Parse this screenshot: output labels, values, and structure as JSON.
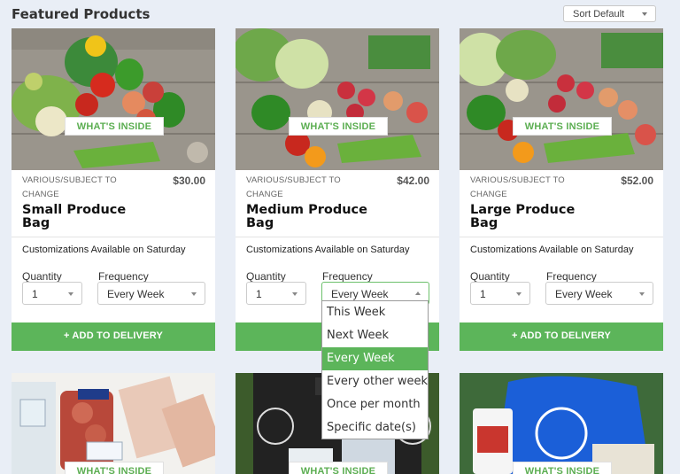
{
  "page": {
    "heading": "Featured Products",
    "sort_label": "Sort Default"
  },
  "products": [
    {
      "badge": "WHAT'S INSIDE",
      "meta": "VARIOUS/SUBJECT TO CHANGE",
      "price": "$30.00",
      "name": "Small Produce Bag",
      "customizations": "Customizations Available on Saturday",
      "quantity_label": "Quantity",
      "quantity": "1",
      "frequency_label": "Frequency",
      "frequency": "Every Week",
      "add_label": "+ ADD TO DELIVERY"
    },
    {
      "badge": "WHAT'S INSIDE",
      "meta": "VARIOUS/SUBJECT TO CHANGE",
      "price": "$42.00",
      "name": "Medium Produce Bag",
      "customizations": "Customizations Available on Saturday",
      "quantity_label": "Quantity",
      "quantity": "1",
      "frequency_label": "Frequency",
      "frequency": "Every Week",
      "add_label": "+ ADD"
    },
    {
      "badge": "WHAT'S INSIDE",
      "meta": "VARIOUS/SUBJECT TO CHANGE",
      "price": "$52.00",
      "name": "Large Produce Bag",
      "customizations": "Customizations Available on Saturday",
      "quantity_label": "Quantity",
      "quantity": "1",
      "frequency_label": "Frequency",
      "frequency": "Every Week",
      "add_label": "+ ADD TO DELIVERY"
    }
  ],
  "second_row": [
    {
      "badge": "WHAT'S INSIDE"
    },
    {
      "badge": "WHAT'S INSIDE"
    },
    {
      "badge": "WHAT'S INSIDE"
    }
  ],
  "frequency_dropdown": {
    "options": [
      "This Week",
      "Next Week",
      "Every Week",
      "Every other week",
      "Once per month",
      "Specific date(s)"
    ],
    "selected": "Every Week"
  },
  "colors": {
    "accent": "#5cb55a",
    "page_bg": "#e9eef6"
  }
}
